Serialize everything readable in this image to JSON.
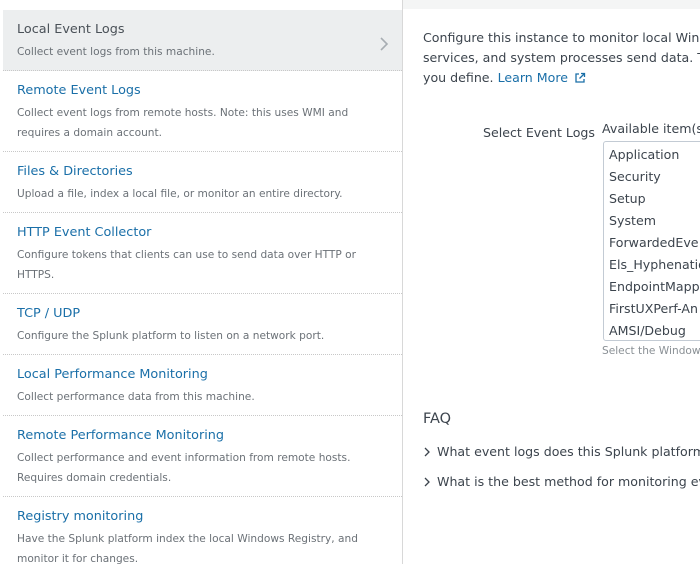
{
  "sidebar": {
    "items": [
      {
        "title": "Local Event Logs",
        "desc": "Collect event logs from this machine."
      },
      {
        "title": "Remote Event Logs",
        "desc": "Collect event logs from remote hosts. Note: this uses WMI and requires a domain account."
      },
      {
        "title": "Files & Directories",
        "desc": "Upload a file, index a local file, or monitor an entire directory."
      },
      {
        "title": "HTTP Event Collector",
        "desc": "Configure tokens that clients can use to send data over HTTP or HTTPS."
      },
      {
        "title": "TCP / UDP",
        "desc": "Configure the Splunk platform to listen on a network port."
      },
      {
        "title": "Local Performance Monitoring",
        "desc": "Collect performance data from this machine."
      },
      {
        "title": "Remote Performance Monitoring",
        "desc": "Collect performance and event information from remote hosts. Requires domain credentials."
      },
      {
        "title": "Registry monitoring",
        "desc": "Have the Splunk platform index the local Windows Registry, and monitor it for changes."
      }
    ]
  },
  "main": {
    "intro_line1": "Configure this instance to monitor local Windo",
    "intro_line2": "services, and system processes send data. Th",
    "intro_line3": "you define.",
    "learn_more": "Learn More",
    "select_label": "Select Event Logs",
    "available_label": "Available item(s)",
    "available_items": [
      "Application",
      "Security",
      "Setup",
      "System",
      "ForwardedEve",
      "Els_Hyphenatio",
      "EndpointMappe",
      "FirstUXPerf-An",
      "AMSI/Debug"
    ],
    "hint": "Select the Window",
    "faq_title": "FAQ",
    "faq": [
      "What event logs does this Splunk platform i",
      "What is the best method for monitoring eve"
    ]
  },
  "colors": {
    "link": "#1a6fa8",
    "active_bg": "#eceeef",
    "text": "#3c444d"
  }
}
